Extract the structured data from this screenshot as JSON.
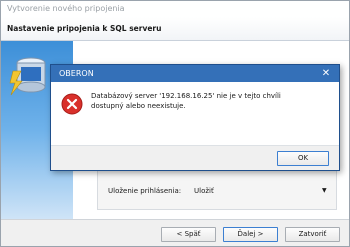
{
  "wizard": {
    "window_title": "Vytvorenie nového pripojenia",
    "header_title": "Nastavenie pripojenia k SQL serveru",
    "save_login_label": "Uloženie prihlásenia:",
    "save_login_value": "Uložiť",
    "buttons": {
      "back": "< Späť",
      "next": "Ďalej >",
      "close": "Zatvoriť"
    }
  },
  "dialog": {
    "title": "OBERON",
    "message": "Databázový server '192.168.16.25' nie je v tejto chvíli dostupný alebo neexistuje.",
    "ok_label": "OK",
    "icon": "error-icon",
    "colors": {
      "titlebar": "#3470b8",
      "error": "#d9302b"
    }
  },
  "colors": {
    "side_panel": "#3d8fd8",
    "accent": "#3c7fd1"
  }
}
